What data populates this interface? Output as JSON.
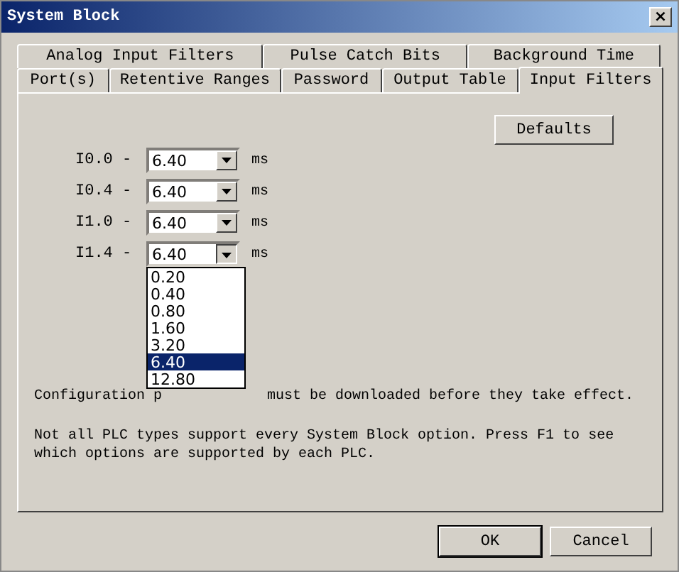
{
  "window": {
    "title": "System Block",
    "close": "×"
  },
  "tab_rows": [
    [
      {
        "label": "Analog Input Filters",
        "selected": false
      },
      {
        "label": "Pulse Catch Bits",
        "selected": false
      },
      {
        "label": "Background Time",
        "selected": false
      }
    ],
    [
      {
        "label": "Port(s)",
        "selected": false
      },
      {
        "label": "Retentive Ranges",
        "selected": false
      },
      {
        "label": "Password",
        "selected": false
      },
      {
        "label": "Output Table",
        "selected": false
      },
      {
        "label": "Input Filters",
        "selected": true
      }
    ]
  ],
  "defaults_button": "Defaults",
  "filters": [
    {
      "label": "I0.0 -",
      "value": "6.40",
      "unit": "ms",
      "expanded": false
    },
    {
      "label": "I0.4 -",
      "value": "6.40",
      "unit": "ms",
      "expanded": false
    },
    {
      "label": "I1.0 -",
      "value": "6.40",
      "unit": "ms",
      "expanded": false
    },
    {
      "label": "I1.4 -",
      "value": "6.40",
      "unit": "ms",
      "expanded": true
    }
  ],
  "dropdown_options": [
    {
      "label": "0.20",
      "selected": false
    },
    {
      "label": "0.40",
      "selected": false
    },
    {
      "label": "0.80",
      "selected": false
    },
    {
      "label": "1.60",
      "selected": false
    },
    {
      "label": "3.20",
      "selected": false
    },
    {
      "label": "6.40",
      "selected": true
    },
    {
      "label": "12.80",
      "selected": false
    }
  ],
  "note_visible_parts": [
    "Configuration p",
    "must be downloaded before they take effect."
  ],
  "info": "Not all PLC types support every System Block option.  Press F1 to see which options are supported by each PLC.",
  "buttons": [
    "OK",
    "Cancel"
  ]
}
